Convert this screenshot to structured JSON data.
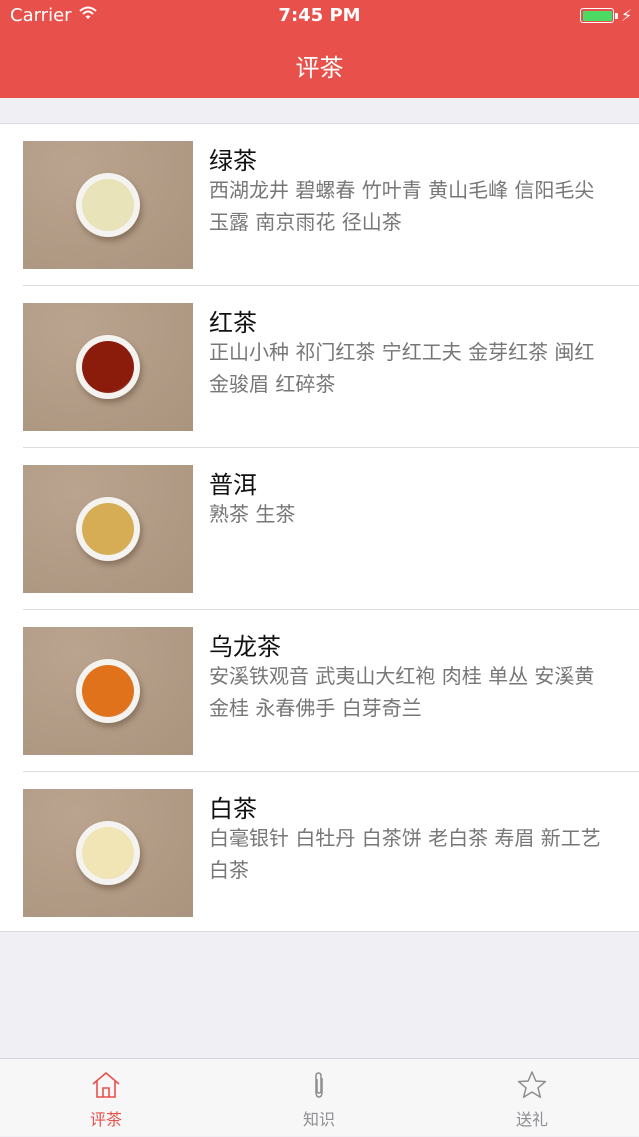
{
  "status_bar": {
    "carrier": "Carrier",
    "time": "7:45 PM"
  },
  "nav": {
    "title": "评茶"
  },
  "colors": {
    "accent": "#e8514b",
    "tab_inactive": "#8e8e93",
    "battery": "#4cd964"
  },
  "teas": [
    {
      "title": "绿茶",
      "description": "西湖龙井 碧螺春 竹叶青 黄山毛峰 信阳毛尖 玉露 南京雨花 径山茶",
      "liquor_color": "#e9e3b9"
    },
    {
      "title": "红茶",
      "description": "正山小种 祁门红茶 宁红工夫 金芽红茶 闽红 金骏眉 红碎茶",
      "liquor_color": "#8b1c0c"
    },
    {
      "title": "普洱",
      "description": "熟茶 生茶",
      "liquor_color": "#d6ad55"
    },
    {
      "title": "乌龙茶",
      "description": "安溪铁观音 武夷山大红袍 肉桂 单丛 安溪黄金桂 永春佛手 白芽奇兰",
      "liquor_color": "#e0721b"
    },
    {
      "title": "白茶",
      "description": "白毫银针 白牡丹 白茶饼 老白茶 寿眉 新工艺白茶",
      "liquor_color": "#f1e5b6"
    }
  ],
  "tabs": [
    {
      "label": "评茶",
      "icon": "house-icon",
      "active": true
    },
    {
      "label": "知识",
      "icon": "paperclip-icon",
      "active": false
    },
    {
      "label": "送礼",
      "icon": "star-icon",
      "active": false
    }
  ]
}
